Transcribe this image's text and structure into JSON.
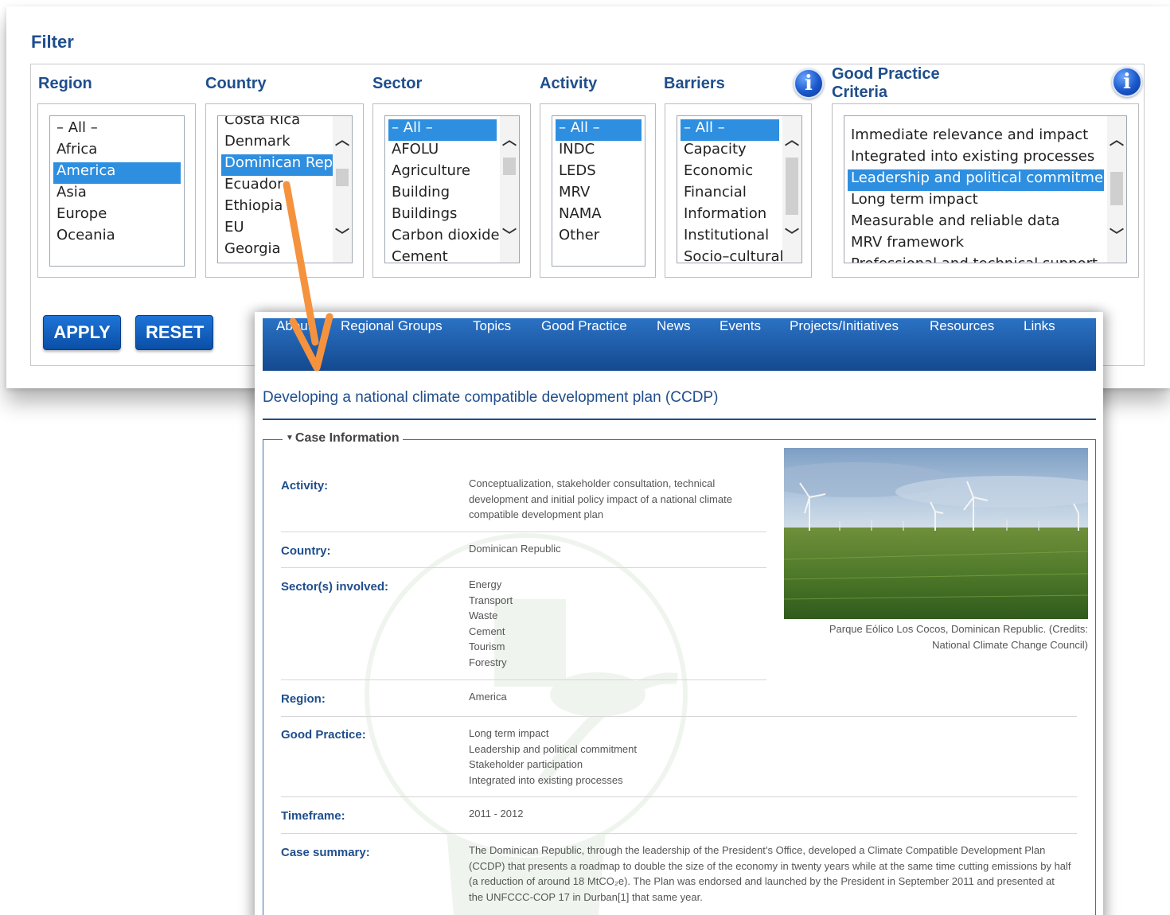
{
  "filter": {
    "title": "Filter",
    "columns": {
      "region": {
        "label": "Region",
        "items": [
          "– All –",
          "Africa",
          "America",
          "Asia",
          "Europe",
          "Oceania"
        ],
        "selected": "America"
      },
      "country": {
        "label": "Country",
        "items": [
          "Costa Rica",
          "Denmark",
          "Dominican Republic",
          "Ecuador",
          "Ethiopia",
          "EU",
          "Georgia"
        ],
        "selected": "Dominican Republic"
      },
      "sector": {
        "label": "Sector",
        "items": [
          "– All –",
          "AFOLU",
          "Agriculture",
          "Building",
          "Buildings",
          "Carbon dioxide",
          "Cement"
        ],
        "selected": "– All –"
      },
      "activity": {
        "label": "Activity",
        "items": [
          "– All –",
          "INDC",
          "LEDS",
          "MRV",
          "NAMA",
          "Other"
        ],
        "selected": "– All –"
      },
      "barriers": {
        "label": "Barriers",
        "items": [
          "– All –",
          "Capacity",
          "Economic",
          "Financial",
          "Information",
          "Institutional",
          "Socio–cultural"
        ],
        "selected": "– All –"
      },
      "good_practice": {
        "label_line1": "Good Practice",
        "label_line2": "Criteria",
        "items": [
          "Immediate relevance and impact",
          "Integrated into existing processes",
          "Leadership and political commitment",
          "Long term impact",
          "Measurable and reliable data",
          "MRV framework",
          "Professional and technical support"
        ],
        "selected": "Leadership and political commitment"
      }
    },
    "info_icon": "i",
    "apply_label": "APPLY",
    "reset_label": "RESET"
  },
  "nav": {
    "items": [
      "About",
      "Regional Groups",
      "Topics",
      "Good Practice",
      "News",
      "Events",
      "Projects/Initiatives",
      "Resources",
      "Links"
    ]
  },
  "page": {
    "title": "Developing a national climate compatible development plan (CCDP)",
    "section_title": "Case Information",
    "rows": [
      {
        "label": "Activity:",
        "lines": [
          "Conceptualization, stakeholder consultation, technical",
          "development and initial policy impact of a national climate",
          "compatible development plan"
        ]
      },
      {
        "label": "Country:",
        "lines": [
          "Dominican Republic"
        ]
      },
      {
        "label": "Sector(s) involved:",
        "lines": [
          "Energy",
          "Transport",
          "Waste",
          "Cement",
          "Tourism",
          "Forestry"
        ]
      },
      {
        "label": "Region:",
        "lines": [
          "America"
        ]
      },
      {
        "label": "Good Practice:",
        "lines": [
          "Long term impact",
          "Leadership and political commitment",
          "Stakeholder participation",
          "Integrated into existing processes"
        ]
      },
      {
        "label": "Timeframe:",
        "lines": [
          "2011 - 2012"
        ]
      },
      {
        "label": "Case summary:",
        "lines": [
          "The Dominican Republic, through the leadership of the President’s Office, developed a Climate Compatible Development Plan",
          "(CCDP) that presents a roadmap to double the size of the economy in twenty years while at the same time cutting emissions by half",
          "(a reduction of around 18 MtCO₂e). The Plan was endorsed and launched by the President in September 2011 and presented at",
          "the UNFCCC-COP 17 in Durban[1] that same year."
        ]
      }
    ],
    "photo_caption": [
      "Parque Eólico Los Cocos, Dominican Republic. (Credits:",
      "National Climate Change Council)"
    ]
  },
  "colors": {
    "brand_blue": "#1f4e8c",
    "selection_blue": "#2e8fe0",
    "arrow_orange": "#f5923e",
    "nav_blue": "#1d5aa6"
  }
}
